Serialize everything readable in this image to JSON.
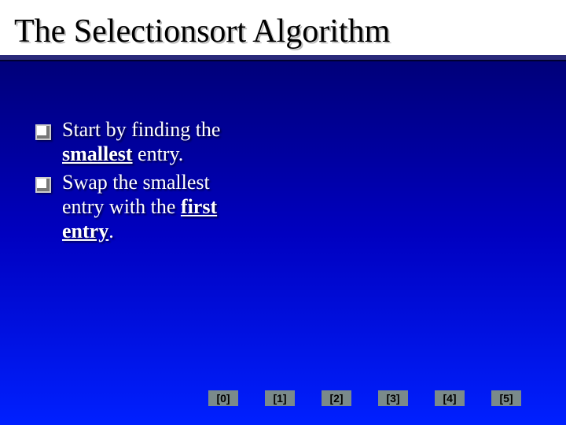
{
  "title": "The Selectionsort Algorithm",
  "bullets": [
    {
      "pre": "Start by finding the ",
      "emph": "smallest",
      "post": " entry."
    },
    {
      "pre": "Swap the smallest entry with the ",
      "emph": "first entry",
      "post": "."
    }
  ],
  "indices": [
    "[0]",
    "[1]",
    "[2]",
    "[3]",
    "[4]",
    "[5]"
  ]
}
